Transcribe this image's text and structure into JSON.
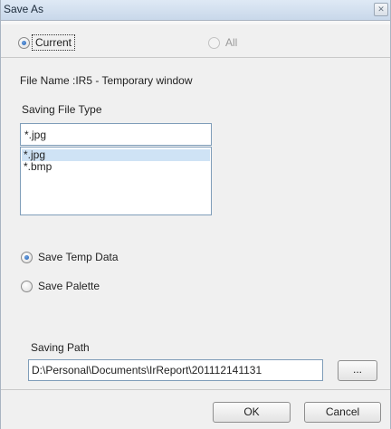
{
  "window": {
    "title": "Save As",
    "close_label": "✕"
  },
  "range": {
    "current_label": "Current",
    "all_label": "All",
    "selected": "Current"
  },
  "file_name": {
    "text": "File Name :IR5 - Temporary window"
  },
  "file_type": {
    "label": "Saving File Type",
    "value": "*.jpg",
    "options": [
      "*.jpg",
      "*.bmp"
    ],
    "selected_index": 0
  },
  "save_options": {
    "temp_data_label": "Save Temp Data",
    "temp_data_checked": true,
    "palette_label": "Save Palette",
    "palette_checked": false
  },
  "saving_path": {
    "label": "Saving Path",
    "value": "D:\\Personal\\Documents\\IrReport\\201112141131",
    "browse_label": "..."
  },
  "buttons": {
    "ok_label": "OK",
    "cancel_label": "Cancel"
  },
  "colors": {
    "selection": "#cfe3f5",
    "radio_accent": "#1f5fb3"
  }
}
